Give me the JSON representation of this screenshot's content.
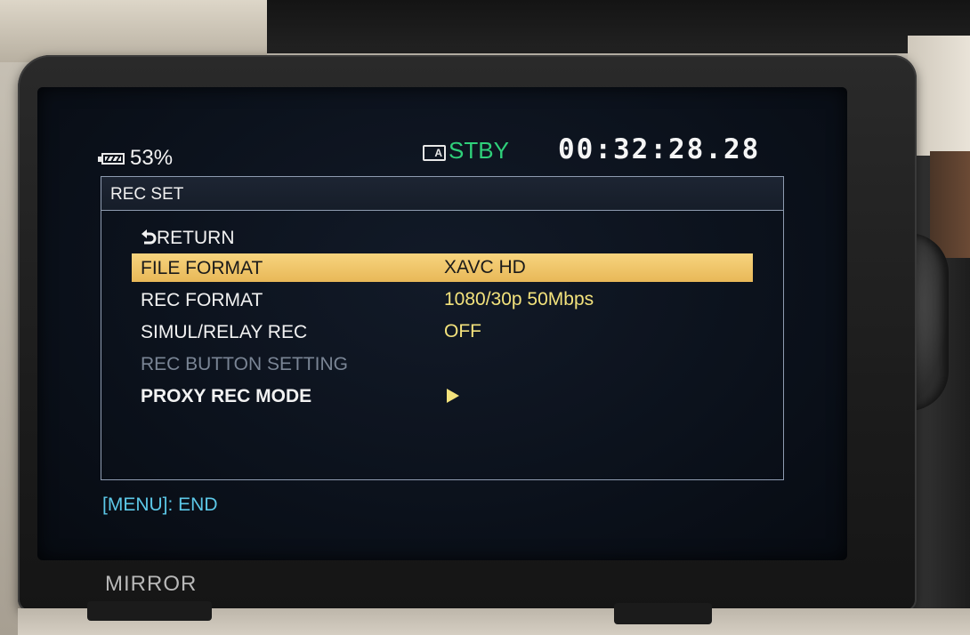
{
  "status": {
    "battery_icon": "battery-icon",
    "battery_percent": "53%",
    "media_icon": "card-a-icon",
    "media_label": "A",
    "rec_state": "STBY",
    "timecode": "00:32:28.28"
  },
  "menu": {
    "title": "REC SET",
    "return_label": "RETURN",
    "items": [
      {
        "label": "FILE FORMAT",
        "value": "XAVC HD",
        "selected": true
      },
      {
        "label": "REC FORMAT",
        "value": "1080/30p 50Mbps"
      },
      {
        "label": "SIMUL/RELAY REC",
        "value": "OFF"
      },
      {
        "label": "REC BUTTON SETTING",
        "value": "",
        "disabled": true
      },
      {
        "label": "PROXY REC MODE",
        "value_icon": "play-arrow-icon"
      }
    ]
  },
  "footer": {
    "hint": "[MENU]: END"
  },
  "body_label": "MIRROR",
  "colors": {
    "selected_bg": "#f0c66a",
    "value_text": "#f3e27c",
    "stby_text": "#2fd07a",
    "hint_text": "#5cc8e8",
    "disabled_text": "#7a8595"
  }
}
